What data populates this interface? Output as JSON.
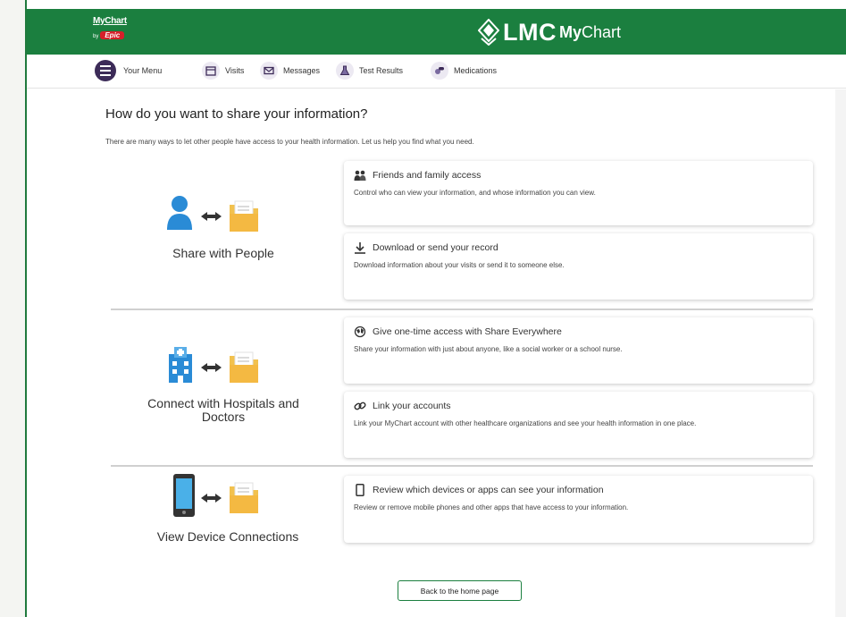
{
  "header": {
    "small_logo_name": "MyChart",
    "small_logo_by": "by",
    "small_logo_brand": "Epic",
    "brand_lmc": "LMC",
    "brand_my": "My",
    "brand_chart": "Chart",
    "color": "#1b7f3f"
  },
  "nav": {
    "menu_label": "Your Menu",
    "items": [
      {
        "label": "Visits",
        "icon": "calendar-icon"
      },
      {
        "label": "Messages",
        "icon": "envelope-icon"
      },
      {
        "label": "Test Results",
        "icon": "flask-icon"
      },
      {
        "label": "Medications",
        "icon": "pills-icon"
      }
    ]
  },
  "main": {
    "title": "How do you want to share your information?",
    "intro": "There are many ways to let other people have access to your health information. Let us help you find what you need.",
    "groups": [
      {
        "label": "Share with People",
        "icon": "person-folder-icon",
        "cards": [
          {
            "title": "Friends and family access",
            "desc": "Control who can view your information, and whose information you can view.",
            "icon": "people-icon"
          },
          {
            "title": "Download or send your record",
            "desc": "Download information about your visits or send it to someone else.",
            "icon": "download-icon"
          }
        ]
      },
      {
        "label": "Connect with Hospitals and Doctors",
        "icon": "hospital-folder-icon",
        "cards": [
          {
            "title": "Give one-time access with Share Everywhere",
            "desc": "Share your information with just about anyone, like a social worker or a school nurse.",
            "icon": "globe-icon"
          },
          {
            "title": "Link your accounts",
            "desc": "Link your MyChart account with other healthcare organizations and see your health information in one place.",
            "icon": "link-icon"
          }
        ]
      },
      {
        "label": "View Device Connections",
        "icon": "phone-folder-icon",
        "cards": [
          {
            "title": "Review which devices or apps can see your information",
            "desc": "Review or remove mobile phones and other apps that have access to your information.",
            "icon": "phone-icon"
          }
        ]
      }
    ],
    "back_button": "Back to the home page"
  }
}
